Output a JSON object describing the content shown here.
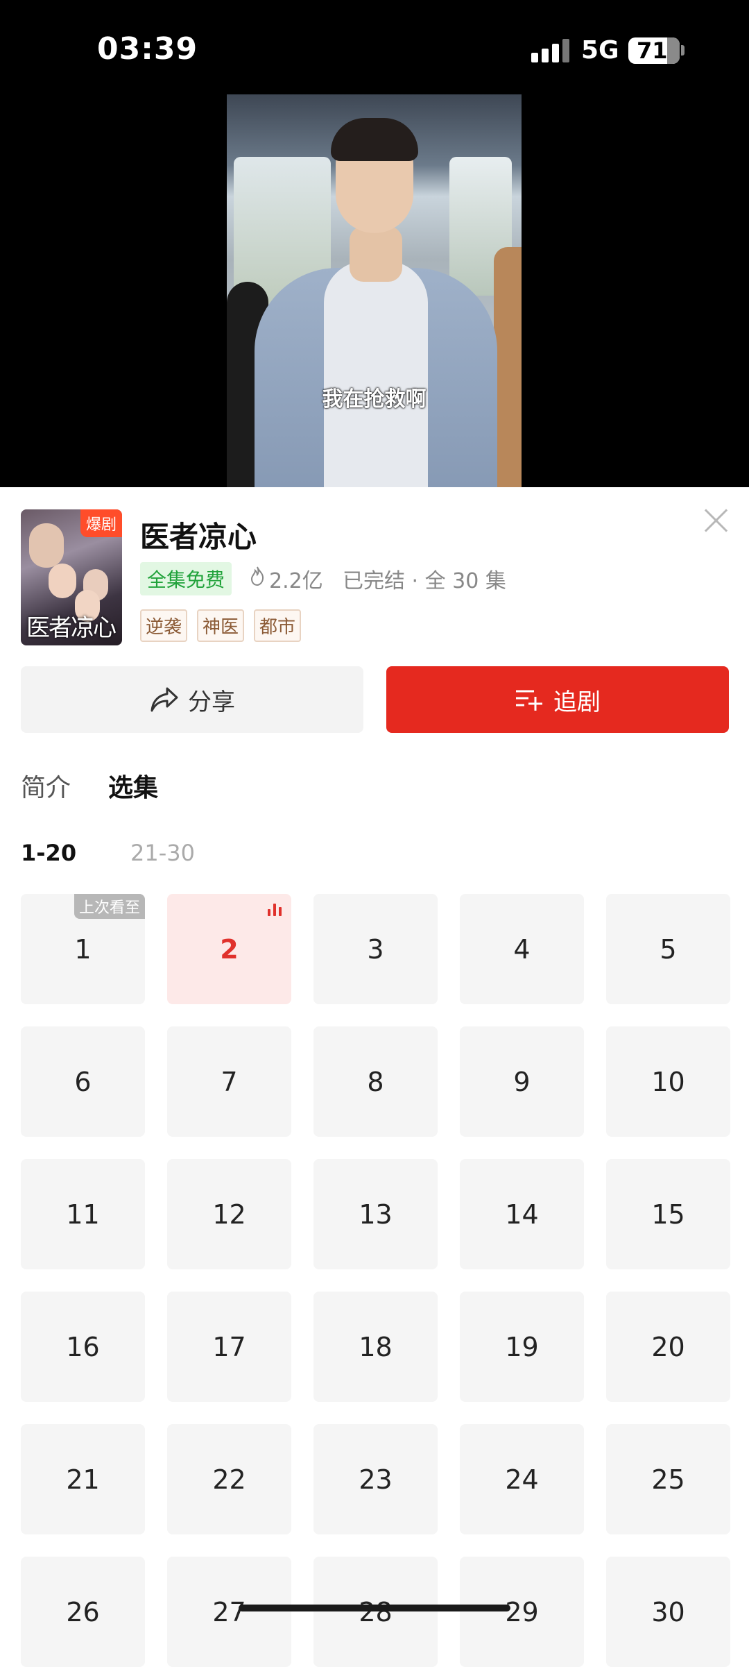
{
  "status_bar": {
    "time": "03:39",
    "network": "5G",
    "battery": "71"
  },
  "video": {
    "subtitle": "我在抢救啊"
  },
  "drama": {
    "poster_badge": "爆剧",
    "poster_title": "医者凉心",
    "title": "医者凉心",
    "free_label": "全集免费",
    "heat": "2.2亿",
    "status": "已完结 · 全 30 集",
    "tags": [
      "逆袭",
      "神医",
      "都市"
    ]
  },
  "actions": {
    "share_label": "分享",
    "follow_label": "追剧"
  },
  "tabs": {
    "intro": "简介",
    "episodes": "选集"
  },
  "ranges": [
    "1-20",
    "21-30"
  ],
  "episodes": {
    "last_watched_badge": "上次看至",
    "current": "2",
    "items": [
      "1",
      "2",
      "3",
      "4",
      "5",
      "6",
      "7",
      "8",
      "9",
      "10",
      "11",
      "12",
      "13",
      "14",
      "15",
      "16",
      "17",
      "18",
      "19",
      "20",
      "21",
      "22",
      "23",
      "24",
      "25",
      "26",
      "27",
      "28",
      "29",
      "30"
    ]
  },
  "colors": {
    "accent": "#e5291f",
    "free_green": "#20a23a",
    "tag_brown": "#8b5a35"
  }
}
